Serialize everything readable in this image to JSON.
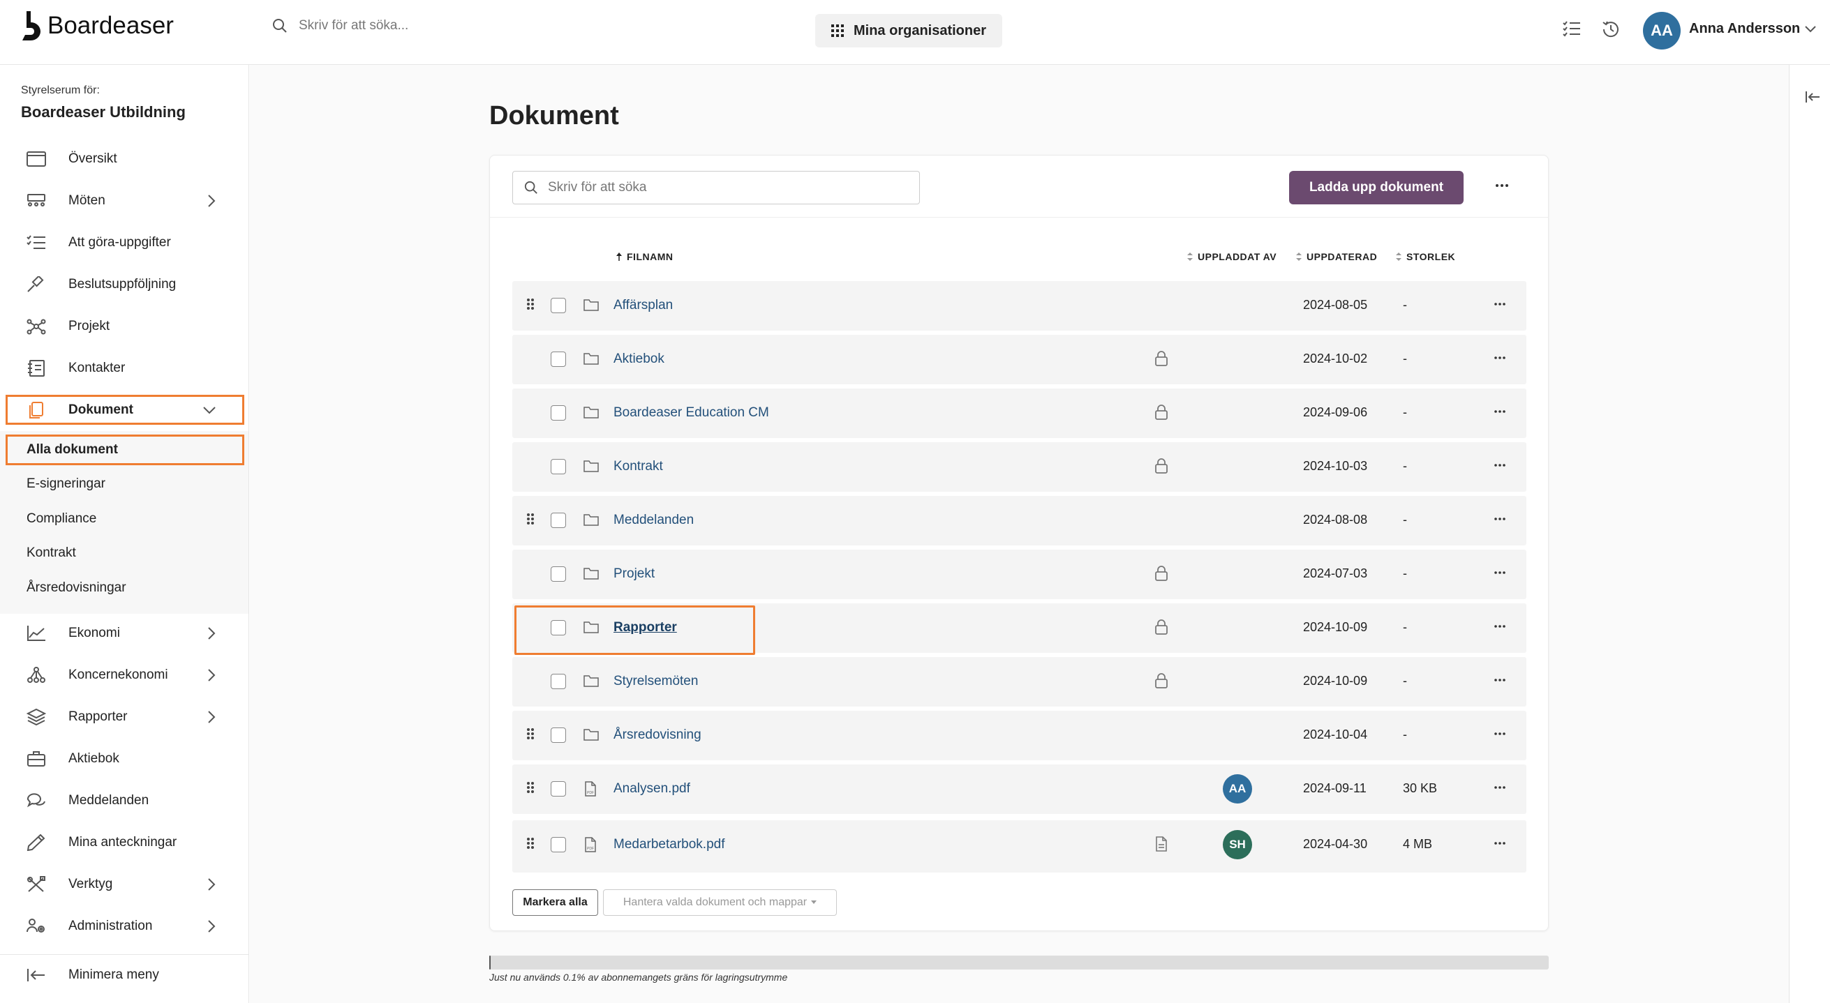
{
  "app": {
    "logo_text": "Boardeaser"
  },
  "topbar": {
    "search_placeholder": "Skriv för att söka...",
    "org_button": "Mina organisationer",
    "user_initials": "AA",
    "user_name": "Anna Andersson"
  },
  "sidebar": {
    "room_label": "Styrelserum för:",
    "room_name": "Boardeaser Utbildning",
    "items": [
      {
        "label": "Översikt",
        "icon": "calendar-icon"
      },
      {
        "label": "Möten",
        "icon": "meeting-icon"
      },
      {
        "label": "Att göra-uppgifter",
        "icon": "checklist-icon"
      },
      {
        "label": "Beslutsuppföljning",
        "icon": "gavel-icon"
      },
      {
        "label": "Projekt",
        "icon": "network-icon"
      },
      {
        "label": "Kontakter",
        "icon": "contacts-icon"
      },
      {
        "label": "Dokument",
        "icon": "document-icon"
      }
    ],
    "sub_items": [
      {
        "label": "Alla dokument"
      },
      {
        "label": "E-signeringar"
      },
      {
        "label": "Compliance"
      },
      {
        "label": "Kontrakt"
      },
      {
        "label": "Årsredovisningar"
      }
    ],
    "items2": [
      {
        "label": "Ekonomi",
        "icon": "chart-icon"
      },
      {
        "label": "Koncernekonomi",
        "icon": "hierarchy-icon"
      },
      {
        "label": "Rapporter",
        "icon": "layers-icon"
      },
      {
        "label": "Aktiebok",
        "icon": "briefcase-icon"
      },
      {
        "label": "Meddelanden",
        "icon": "chat-icon"
      },
      {
        "label": "Mina anteckningar",
        "icon": "pencil-icon"
      },
      {
        "label": "Verktyg",
        "icon": "tools-icon"
      },
      {
        "label": "Administration",
        "icon": "admin-icon"
      }
    ],
    "minimize": "Minimera meny"
  },
  "main": {
    "title": "Dokument",
    "search_placeholder": "Skriv för att söka",
    "upload_button": "Ladda upp dokument",
    "columns": {
      "filename": "FILNAMN",
      "uploaded_by": "UPPLADDAT AV",
      "updated": "UPPDATERAD",
      "size": "STORLEK"
    },
    "rows": [
      {
        "name": "Affärsplan",
        "date": "2024-08-05",
        "size": "-"
      },
      {
        "name": "Aktiebok",
        "date": "2024-10-02",
        "size": "-"
      },
      {
        "name": "Boardeaser Education CM",
        "date": "2024-09-06",
        "size": "-"
      },
      {
        "name": "Kontrakt",
        "date": "2024-10-03",
        "size": "-"
      },
      {
        "name": "Meddelanden",
        "date": "2024-08-08",
        "size": "-"
      },
      {
        "name": "Projekt",
        "date": "2024-07-03",
        "size": "-"
      },
      {
        "name": "Rapporter",
        "date": "2024-10-09",
        "size": "-"
      },
      {
        "name": "Styrelsemöten",
        "date": "2024-10-09",
        "size": "-"
      },
      {
        "name": "Årsredovisning",
        "date": "2024-10-04",
        "size": "-"
      },
      {
        "name": "Analysen.pdf",
        "uploader": "AA",
        "uploader_color": "#2f6f9e",
        "date": "2024-09-11",
        "size": "30 KB"
      },
      {
        "name": "Medarbetarbok.pdf",
        "uploader": "SH",
        "uploader_color": "#2c6e5a",
        "date": "2024-04-30",
        "size": "4 MB"
      }
    ],
    "select_all": "Markera alla",
    "manage_selected": "Hantera valda dokument och mappar",
    "storage_text": "Just nu används 0.1% av abonnemangets gräns för lagringsutrymme",
    "storage_used_percent": 0.1
  },
  "colors": {
    "accent": "#6b4a6f",
    "highlight": "#ef7d31",
    "link": "#23507a"
  }
}
